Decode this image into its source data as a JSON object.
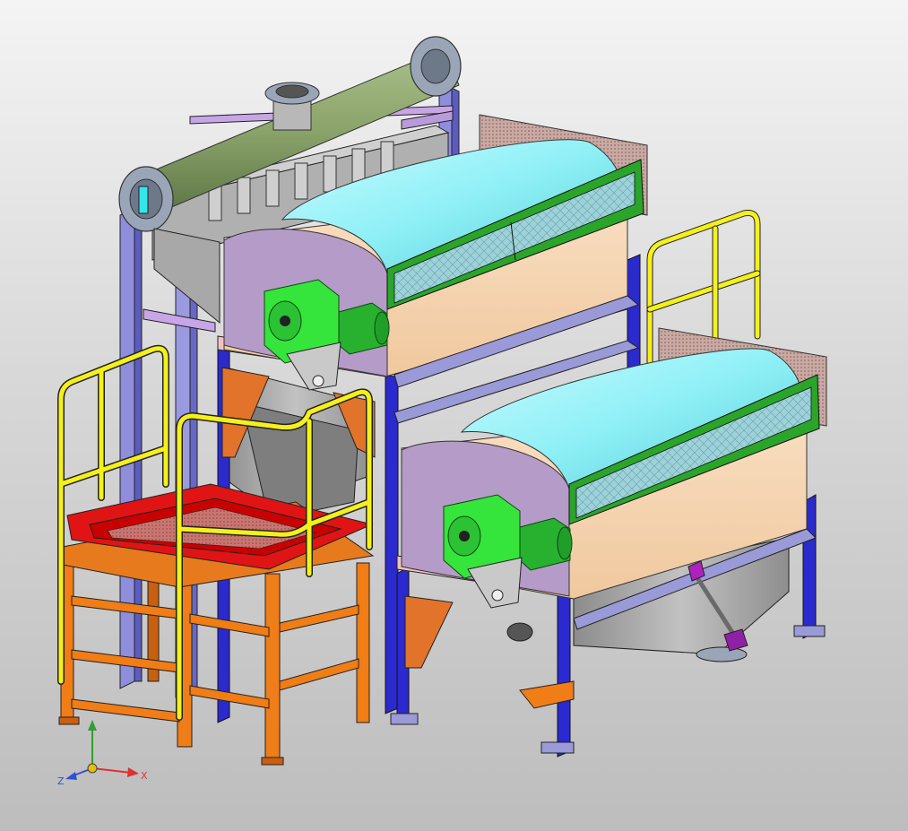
{
  "viewport": {
    "background_top": "#f4f4f4",
    "background_bottom": "#bdbdbd"
  },
  "colors": {
    "pipe": "#8aa36a",
    "flange": "#9aa6b8",
    "frame_blue": "#2a2ad0",
    "frame_violet": "#9a9ad8",
    "drum_cyan": "#8ef0f6",
    "drum_body": "#f7d6b0",
    "drum_end": "#b8a0c8",
    "gear_green": "#33e03a",
    "motor_green": "#2bbd32",
    "trim_green": "#1f9e2a",
    "mesh": "#caa8a0",
    "hopper": "#a9a9a9",
    "orange": "#f07d15",
    "red_tray": "#e01414",
    "rail_yellow": "#f5f01a",
    "pink": "#f2bcbc"
  },
  "triad": {
    "x_label": "X",
    "y_label": "Y",
    "z_label": "Z",
    "x_color": "#e03030",
    "y_color": "#30a030",
    "z_color": "#3050d0"
  }
}
